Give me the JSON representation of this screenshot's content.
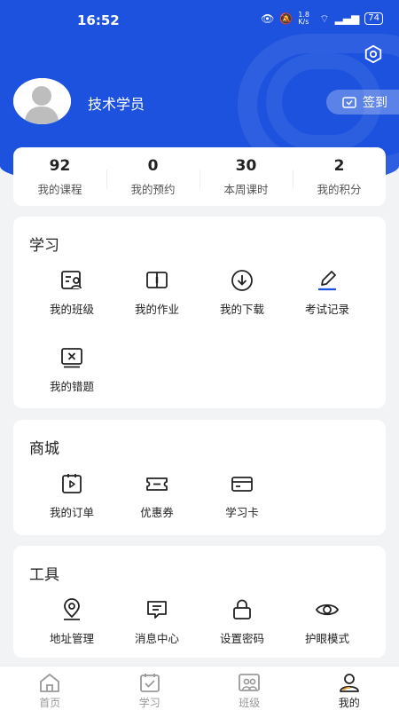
{
  "status_bar": {
    "time": "16:52",
    "net_speed": "1.8 K/s",
    "battery": "74"
  },
  "profile": {
    "name": "技术学员",
    "signin_label": "签到"
  },
  "stats": [
    {
      "value": "92",
      "label": "我的课程"
    },
    {
      "value": "0",
      "label": "我的预约"
    },
    {
      "value": "30",
      "label": "本周课时"
    },
    {
      "value": "2",
      "label": "我的积分"
    }
  ],
  "study": {
    "title": "学习",
    "items": [
      {
        "label": "我的班级",
        "icon": "class-icon"
      },
      {
        "label": "我的作业",
        "icon": "book-icon"
      },
      {
        "label": "我的下载",
        "icon": "download-icon"
      },
      {
        "label": "考试记录",
        "icon": "edit-icon"
      },
      {
        "label": "我的错题",
        "icon": "wrong-question-icon"
      }
    ]
  },
  "mall": {
    "title": "商城",
    "items": [
      {
        "label": "我的订单",
        "icon": "order-icon"
      },
      {
        "label": "优惠券",
        "icon": "coupon-icon"
      },
      {
        "label": "学习卡",
        "icon": "card-icon"
      }
    ]
  },
  "tools": {
    "title": "工具",
    "items": [
      {
        "label": "地址管理",
        "icon": "location-icon"
      },
      {
        "label": "消息中心",
        "icon": "message-icon"
      },
      {
        "label": "设置密码",
        "icon": "lock-icon"
      },
      {
        "label": "护眼模式",
        "icon": "eye-icon"
      }
    ]
  },
  "tabbar": [
    {
      "label": "首页",
      "icon": "home-icon",
      "active": false
    },
    {
      "label": "学习",
      "icon": "calendar-icon",
      "active": false
    },
    {
      "label": "班级",
      "icon": "group-icon",
      "active": false
    },
    {
      "label": "我的",
      "icon": "user-icon",
      "active": true
    }
  ],
  "colors": {
    "brand": "#1d52de",
    "background": "#f2f3f5",
    "text": "#222222",
    "muted": "#999999"
  }
}
